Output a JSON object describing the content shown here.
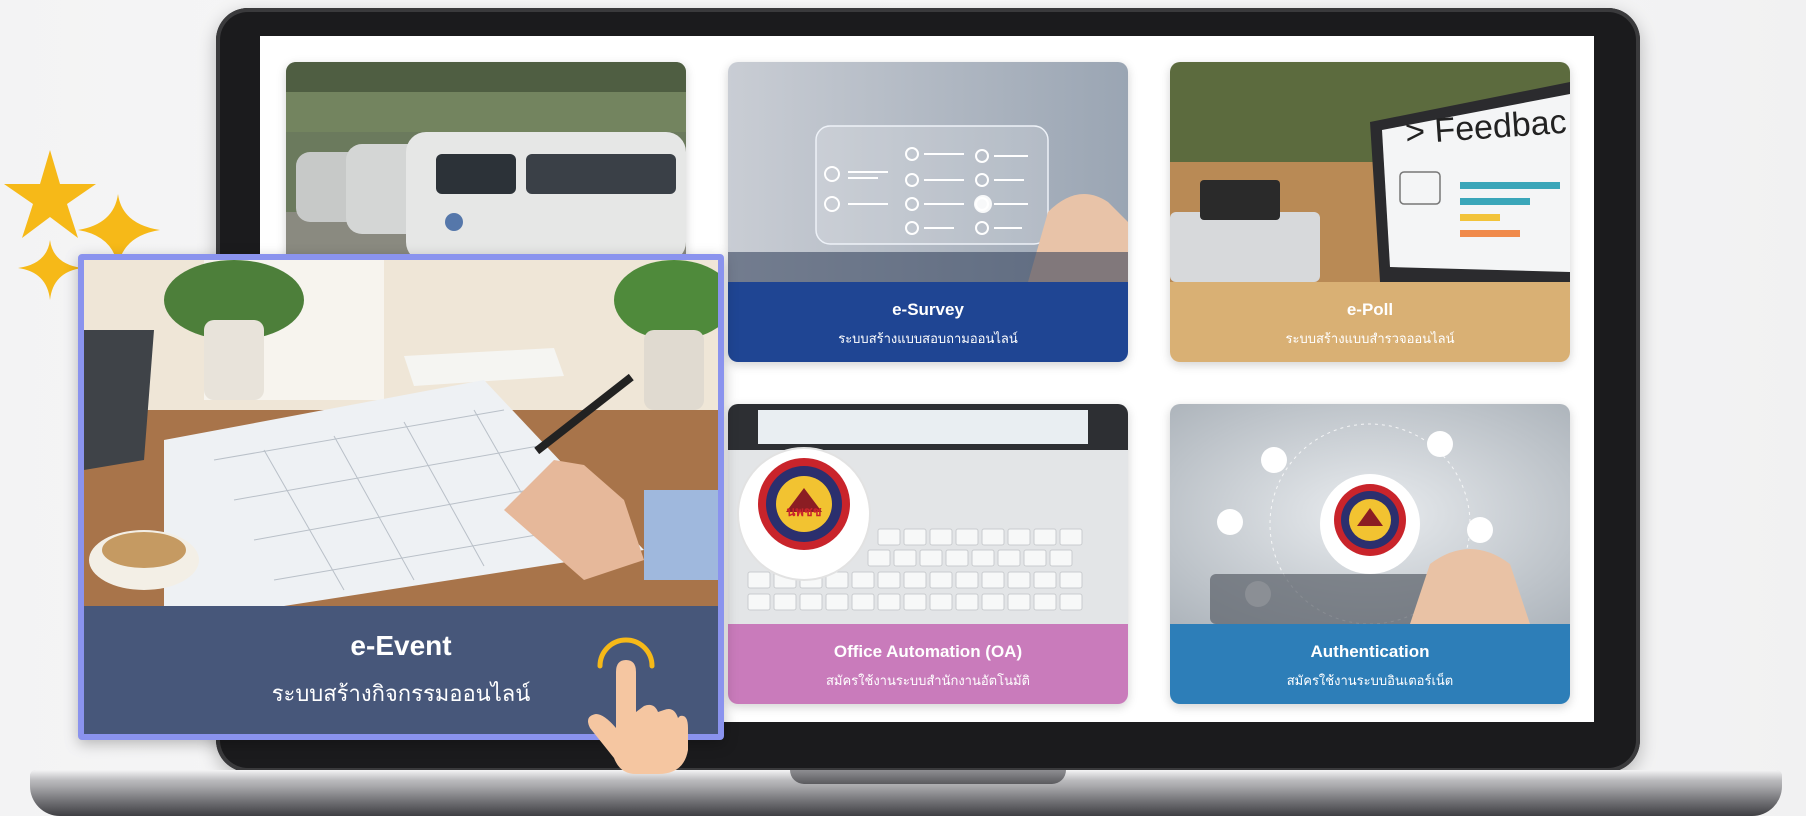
{
  "cards": {
    "e_survey": {
      "title": "e-Survey",
      "subtitle": "ระบบสร้างแบบสอบถามออนไลน์",
      "color": "#1f4593"
    },
    "e_poll": {
      "title": "e-Poll",
      "subtitle": "ระบบสร้างแบบสำรวจออนไลน์",
      "color": "#d9b074"
    },
    "oa": {
      "title": "Office Automation (OA)",
      "subtitle": "สมัครใช้งานระบบสำนักงานอัตโนมัติ",
      "color": "#c97bbb"
    },
    "auth": {
      "title": "Authentication",
      "subtitle": "สมัครใช้งานระบบอินเตอร์เน็ต",
      "color": "#2d7eb8"
    },
    "vehicle": {
      "title": "",
      "subtitle": ""
    }
  },
  "highlight": {
    "title": "e-Event",
    "subtitle": "ระบบสร้างกิจกรรมออนไลน์",
    "border_color": "#8a93ee",
    "band_color": "#47577a"
  },
  "poll_image_text": "> Feedbac",
  "icons": {
    "stars": "sparkle-stars-icon",
    "pointer": "tap-hand-icon",
    "logo": "department-seal-logo"
  },
  "logo_text": "กรมการพัฒนาชุมชน"
}
